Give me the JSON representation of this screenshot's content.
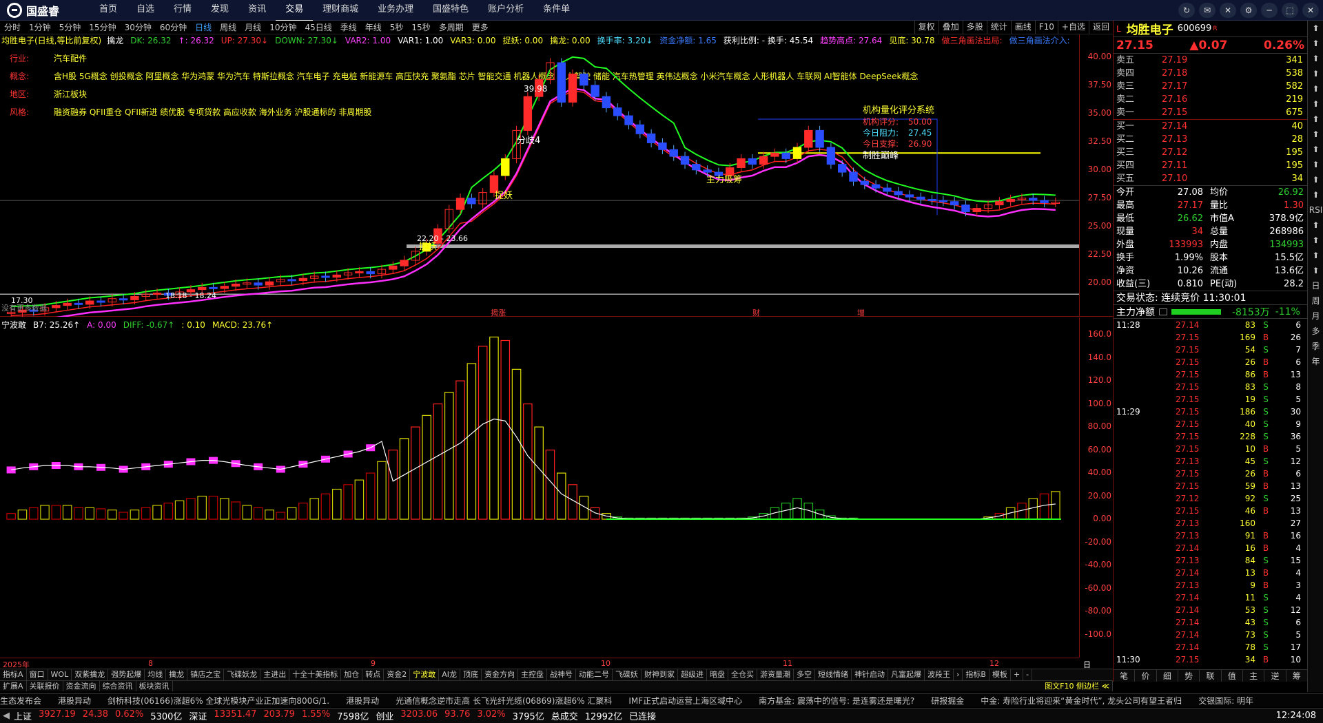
{
  "app": {
    "logo_text": "国盛睿"
  },
  "menu": [
    "首页",
    "自选",
    "行情",
    "发现",
    "资讯",
    "交易",
    "理财商城",
    "业务办理",
    "国盛特色",
    "账户分析",
    "条件单"
  ],
  "menu_active": "交易",
  "window_buttons": [
    "↻",
    "✉",
    "✕",
    "⚙",
    "─",
    "⬚",
    "✕"
  ],
  "periods": [
    "分时",
    "1分钟",
    "5分钟",
    "15分钟",
    "30分钟",
    "60分钟",
    "日线",
    "周线",
    "月线",
    "10分钟",
    "45日线",
    "季线",
    "年线",
    "5秒",
    "15秒",
    "多周期",
    "更多"
  ],
  "period_active": "日线",
  "chart_tools": [
    "复权",
    "叠加",
    "多股",
    "统计",
    "画线",
    "F10",
    "+自选",
    "返回"
  ],
  "indicator_main": {
    "name": "均胜电子(日线,等比前复权)",
    "items": [
      {
        "t": "擒龙",
        "c": "white"
      },
      {
        "t": "DK: 26.32",
        "c": "green"
      },
      {
        "t": "↑: 26.32",
        "c": "mag"
      },
      {
        "t": "UP: 27.30↓",
        "c": "red"
      },
      {
        "t": "DOWN: 27.30↓",
        "c": "green"
      },
      {
        "t": "VAR2: 1.00",
        "c": "mag"
      },
      {
        "t": "VAR1: 1.00",
        "c": "white"
      },
      {
        "t": "VAR3: 0.00",
        "c": "yellow"
      },
      {
        "t": "捉妖: 0.00",
        "c": "yellow"
      },
      {
        "t": "擒龙: 0.00",
        "c": "yellow"
      },
      {
        "t": "换手率: 3.20↓",
        "c": "cyan"
      },
      {
        "t": "资金净额: 1.65",
        "c": "blue"
      },
      {
        "t": "获利比例: - 换手: 45.54",
        "c": "white"
      },
      {
        "t": "趋势高点: 27.64",
        "c": "mag"
      },
      {
        "t": "见底: 30.78",
        "c": "yellow"
      },
      {
        "t": "做三角画法出局:",
        "c": "red"
      },
      {
        "t": "做三角画法介入:",
        "c": "blue"
      }
    ]
  },
  "stock_info": [
    {
      "label": "行业:",
      "value": "汽车配件"
    },
    {
      "label": "概念:",
      "value": "含H股 5G概念 创投概念 阿里概念 华为鸿蒙 华为汽车 特斯拉概念 汽车电子 充电桩 新能源车 高压快充 聚氨酯 芯片 智能交通 机器人概念 无人驾驶 储能 汽车热管理 英伟达概念 小米汽车概念 人形机器人 车联网 AI智能体 DeepSeek概念"
    },
    {
      "label": "地区:",
      "value": "浙江板块"
    },
    {
      "label": "风格:",
      "value": "融资融券 QFII重仓 QFII新进 绩优股 专项贷款 高应收款 海外业务 沪股通标的 非周期股"
    }
  ],
  "eval_box": {
    "title": "机构量化评分系统",
    "rows": [
      {
        "k": "机构评分:",
        "v": "50.00"
      },
      {
        "k": "今日阻力:",
        "v": "27.45"
      },
      {
        "k": "今日支撑:",
        "v": "26.90"
      }
    ],
    "footer": "制胜巅峰"
  },
  "chart_labels": {
    "peak": "39.98",
    "fen": "分歧4",
    "zhuoyao": "捉妖",
    "zhuoyao2": "捉妖",
    "range": "22.20 - 23.66",
    "mainforce": "主力吸筹",
    "low_price": "17.30",
    "low2": "18.18 - 18.24",
    "nodata": "没有更多数据",
    "event1": "揭涨",
    "event2": "财",
    "event3": "增"
  },
  "y_main": [
    "40.00",
    "37.50",
    "35.00",
    "32.50",
    "30.00",
    "27.50",
    "25.00",
    "22.50",
    "20.00"
  ],
  "indicator_sub": {
    "items": [
      {
        "t": "宁波敢",
        "c": "white"
      },
      {
        "t": "B7: 25.26↑",
        "c": "white"
      },
      {
        "t": "A: 0.00",
        "c": "mag"
      },
      {
        "t": "DIFF: -0.67↑",
        "c": "green"
      },
      {
        "t": ": 0.10",
        "c": "yellow"
      },
      {
        "t": "MACD: 23.76↑",
        "c": "yellow"
      }
    ]
  },
  "y_sub": [
    "160.0",
    "140.0",
    "120.0",
    "100.0",
    "80.00",
    "60.00",
    "40.00",
    "20.00",
    "0.00",
    "-20.00",
    "-40.00",
    "-60.00",
    "-80.00",
    "-100.0"
  ],
  "x_axis": [
    "2025年",
    "8",
    "9",
    "10",
    "11",
    "12",
    "日线"
  ],
  "tabs_row1": [
    "指标A",
    "窗口",
    "WOL",
    "双紫擒龙",
    "强势起爆",
    "均线",
    "擒龙",
    "镇店之宝",
    "飞碟妖龙",
    "主进出",
    "十全十美指标",
    "加仓",
    "转点",
    "资金2",
    "宁波敢",
    "AI龙",
    "顶底",
    "资金方向",
    "主控盘",
    "战神号",
    "动能二号",
    "飞碟妖",
    "财神到家",
    "超级进",
    "暗盘",
    "全仓买",
    "游资量潮",
    "多空",
    "短线情绪",
    "神针启动",
    "凡富起爆",
    "波段王",
    "›",
    "指标B",
    "模板",
    "+",
    "-"
  ],
  "tabs_row1_active": "宁波敢",
  "tabs_row2": [
    "扩展A",
    "关联报价",
    "资金流向",
    "综合资讯",
    "板块资讯"
  ],
  "tabs_row2_right": "图文F10 侧边栏 ≪",
  "quote": {
    "name": "均胜电子",
    "code": "600699",
    "flag": "R",
    "price": "27.15",
    "change": "▲0.07",
    "pct": "0.26%",
    "asks": [
      {
        "l": "卖五",
        "p": "27.19",
        "v": "341"
      },
      {
        "l": "卖四",
        "p": "27.18",
        "v": "538"
      },
      {
        "l": "卖三",
        "p": "27.17",
        "v": "582"
      },
      {
        "l": "卖二",
        "p": "27.16",
        "v": "219"
      },
      {
        "l": "卖一",
        "p": "27.15",
        "v": "675"
      }
    ],
    "bids": [
      {
        "l": "买一",
        "p": "27.14",
        "v": "40"
      },
      {
        "l": "买二",
        "p": "27.13",
        "v": "28"
      },
      {
        "l": "买三",
        "p": "27.12",
        "v": "195"
      },
      {
        "l": "买四",
        "p": "27.11",
        "v": "195"
      },
      {
        "l": "买五",
        "p": "27.10",
        "v": "34"
      }
    ],
    "stats": [
      {
        "k1": "今开",
        "v1": "27.08",
        "c1": "white",
        "k2": "均价",
        "v2": "26.92",
        "c2": "green"
      },
      {
        "k1": "最高",
        "v1": "27.17",
        "c1": "red",
        "k2": "量比",
        "v2": "1.30",
        "c2": "red"
      },
      {
        "k1": "最低",
        "v1": "26.62",
        "c1": "green",
        "k2": "市值A",
        "v2": "378.9亿",
        "c2": "white"
      },
      {
        "k1": "现量",
        "v1": "34",
        "c1": "red",
        "k2": "总量",
        "v2": "268986",
        "c2": "white"
      },
      {
        "k1": "外盘",
        "v1": "133993",
        "c1": "red",
        "k2": "内盘",
        "v2": "134993",
        "c2": "green"
      },
      {
        "k1": "换手",
        "v1": "1.99%",
        "c1": "white",
        "k2": "股本",
        "v2": "15.5亿",
        "c2": "white"
      },
      {
        "k1": "净资",
        "v1": "10.26",
        "c1": "white",
        "k2": "流通",
        "v2": "13.6亿",
        "c2": "white"
      },
      {
        "k1": "收益(三)",
        "v1": "0.810",
        "c1": "white",
        "k2": "PE(动)",
        "v2": "28.2",
        "c2": "white"
      }
    ],
    "trade_state": "交易状态: 连续竞价 11:30:01",
    "netflow_label": "主力净额",
    "netflow_value": "-8153万",
    "netflow_pct": "-11%"
  },
  "ticks": [
    {
      "t": "11:28",
      "p": "27.14",
      "v": "83",
      "d": "S",
      "n": "6"
    },
    {
      "t": "",
      "p": "27.15",
      "v": "169",
      "d": "B",
      "n": "26"
    },
    {
      "t": "",
      "p": "27.15",
      "v": "54",
      "d": "S",
      "n": "7"
    },
    {
      "t": "",
      "p": "27.15",
      "v": "26",
      "d": "B",
      "n": "6"
    },
    {
      "t": "",
      "p": "27.15",
      "v": "86",
      "d": "B",
      "n": "13"
    },
    {
      "t": "",
      "p": "27.15",
      "v": "83",
      "d": "S",
      "n": "8"
    },
    {
      "t": "",
      "p": "27.15",
      "v": "19",
      "d": "S",
      "n": "5"
    },
    {
      "t": "11:29",
      "p": "27.15",
      "v": "186",
      "d": "S",
      "n": "30"
    },
    {
      "t": "",
      "p": "27.15",
      "v": "40",
      "d": "S",
      "n": "9"
    },
    {
      "t": "",
      "p": "27.15",
      "v": "228",
      "d": "S",
      "n": "36"
    },
    {
      "t": "",
      "p": "27.15",
      "v": "10",
      "d": "B",
      "n": "5"
    },
    {
      "t": "",
      "p": "27.13",
      "v": "45",
      "d": "S",
      "n": "12"
    },
    {
      "t": "",
      "p": "27.15",
      "v": "26",
      "d": "B",
      "n": "6"
    },
    {
      "t": "",
      "p": "27.15",
      "v": "59",
      "d": "B",
      "n": "13"
    },
    {
      "t": "",
      "p": "27.12",
      "v": "92",
      "d": "S",
      "n": "25"
    },
    {
      "t": "",
      "p": "27.15",
      "v": "46",
      "d": "B",
      "n": "13"
    },
    {
      "t": "",
      "p": "27.13",
      "v": "160",
      "d": "",
      "n": "27"
    },
    {
      "t": "",
      "p": "27.13",
      "v": "91",
      "d": "B",
      "n": "16"
    },
    {
      "t": "",
      "p": "27.14",
      "v": "16",
      "d": "B",
      "n": "4"
    },
    {
      "t": "",
      "p": "27.13",
      "v": "84",
      "d": "S",
      "n": "15"
    },
    {
      "t": "",
      "p": "27.14",
      "v": "13",
      "d": "B",
      "n": "4"
    },
    {
      "t": "",
      "p": "27.13",
      "v": "9",
      "d": "B",
      "n": "3"
    },
    {
      "t": "",
      "p": "27.14",
      "v": "11",
      "d": "S",
      "n": "4"
    },
    {
      "t": "",
      "p": "27.14",
      "v": "53",
      "d": "S",
      "n": "12"
    },
    {
      "t": "",
      "p": "27.14",
      "v": "43",
      "d": "S",
      "n": "6"
    },
    {
      "t": "",
      "p": "27.14",
      "v": "73",
      "d": "S",
      "n": "5"
    },
    {
      "t": "",
      "p": "27.14",
      "v": "78",
      "d": "S",
      "n": "17"
    },
    {
      "t": "11:30",
      "p": "27.15",
      "v": "34",
      "d": "B",
      "n": "10"
    }
  ],
  "right_bottom_tabs": [
    "笔",
    "价",
    "细",
    "势",
    "联",
    "值",
    "主",
    "逆",
    "筹"
  ],
  "vertical_tabs": [
    "⬆",
    "⬆",
    "⬆",
    "⬆",
    "⬆",
    "⬆",
    "⬆",
    "⬆",
    "⬆",
    "⬆",
    "⬆",
    "⬆",
    "RSI",
    "⬆",
    "⬆",
    "⬆",
    "⬆",
    "日",
    "周",
    "月",
    "多",
    "季",
    "年"
  ],
  "ticker_news": [
    "生态发布会",
    "港股异动",
    "剑桥科技(06166)涨超6% 全球光模块产业正加速向800G/1.",
    "港股异动",
    "光通信概念逆市走高 长飞光纤光缆(06869)涨超6% 汇聚科",
    "IMF正式启动运营上海区域中心",
    "南方基金: 震荡中的信号: 是连雾还是曙光?",
    "研报掘金",
    "中金: 寿险行业将迎来“黄金时代”, 龙头公司有望王者归",
    "交银国际: 明年"
  ],
  "status": {
    "items": [
      {
        "t": "上证",
        "c": "white"
      },
      {
        "t": "3927.19",
        "c": "red"
      },
      {
        "t": "24.38",
        "c": "red"
      },
      {
        "t": "0.62%",
        "c": "red"
      },
      {
        "t": "5300亿",
        "c": "white"
      },
      {
        "t": "深证",
        "c": "white"
      },
      {
        "t": "13351.47",
        "c": "red"
      },
      {
        "t": "203.79",
        "c": "red"
      },
      {
        "t": "1.55%",
        "c": "red"
      },
      {
        "t": "7598亿",
        "c": "white"
      },
      {
        "t": "创业",
        "c": "white"
      },
      {
        "t": "3203.06",
        "c": "red"
      },
      {
        "t": "93.76",
        "c": "red"
      },
      {
        "t": "3.02%",
        "c": "red"
      },
      {
        "t": "3795亿",
        "c": "white"
      },
      {
        "t": "总成交",
        "c": "white"
      },
      {
        "t": "12992亿",
        "c": "white"
      },
      {
        "t": "已连接",
        "c": "white"
      }
    ],
    "clock": "12:24:08"
  },
  "chart_data": [
    {
      "type": "candlestick",
      "title": "均胜电子(日线,等比前复权)",
      "ylim": [
        17,
        42
      ],
      "x": [
        "2025年",
        "8",
        "9",
        "10",
        "11",
        "12"
      ],
      "annotations": [
        "39.98",
        "22.20 - 23.66",
        "17.30",
        "18.18 - 18.24"
      ],
      "close": [
        17.4,
        17.6,
        17.5,
        17.8,
        18.0,
        18.2,
        18.1,
        18.4,
        18.3,
        18.6,
        18.5,
        18.8,
        19.0,
        19.1,
        18.9,
        19.2,
        19.4,
        19.6,
        19.5,
        19.7,
        19.9,
        20.0,
        19.8,
        20.1,
        20.3,
        20.2,
        20.4,
        20.6,
        20.5,
        20.7,
        20.9,
        21.0,
        20.8,
        21.2,
        21.5,
        22.0,
        22.8,
        23.5,
        24.8,
        26.5,
        27.5,
        27.0,
        28.0,
        29.5,
        31.0,
        33.5,
        36.5,
        38.0,
        39.5,
        36.0,
        38.5,
        37.5,
        36.5,
        35.5,
        34.8,
        34.0,
        33.2,
        32.4,
        31.8,
        31.2,
        30.5,
        30.0,
        29.8,
        29.5,
        30.2,
        31.0,
        30.5,
        31.2,
        31.5,
        31.0,
        32.0,
        33.5,
        32.0,
        30.5,
        29.8,
        29.0,
        28.7,
        28.4,
        28.1,
        27.8,
        27.6,
        27.4,
        27.3,
        27.2,
        26.9,
        26.3,
        26.6,
        26.9,
        27.2,
        27.4,
        27.5,
        27.3,
        27.1,
        27.15
      ],
      "series": [
        {
          "name": "UP",
          "values": []
        },
        {
          "name": "DOWN",
          "values": []
        }
      ]
    },
    {
      "type": "bar",
      "title": "宁波敢",
      "ylim": [
        -100,
        160
      ],
      "values": [
        5,
        8,
        10,
        12,
        12,
        12,
        10,
        10,
        9,
        8,
        6,
        8,
        10,
        12,
        14,
        16,
        18,
        20,
        20,
        18,
        15,
        12,
        10,
        8,
        6,
        10,
        14,
        18,
        22,
        26,
        30,
        34,
        40,
        50,
        60,
        70,
        80,
        90,
        100,
        110,
        120,
        135,
        150,
        158,
        155,
        130,
        100,
        80,
        60,
        40,
        30,
        20,
        10,
        5,
        2,
        1,
        1,
        1,
        1,
        1,
        1,
        1,
        1,
        1,
        1,
        1,
        2,
        5,
        10,
        14,
        18,
        14,
        8,
        3,
        1,
        1,
        0,
        0,
        0,
        0,
        0,
        0,
        0,
        0,
        0,
        0,
        0,
        2,
        5,
        10,
        14,
        18,
        22,
        24
      ],
      "series": [
        {
          "name": "A",
          "values": []
        },
        {
          "name": "DIFF",
          "values": []
        },
        {
          "name": "MACD",
          "values": []
        }
      ]
    }
  ]
}
